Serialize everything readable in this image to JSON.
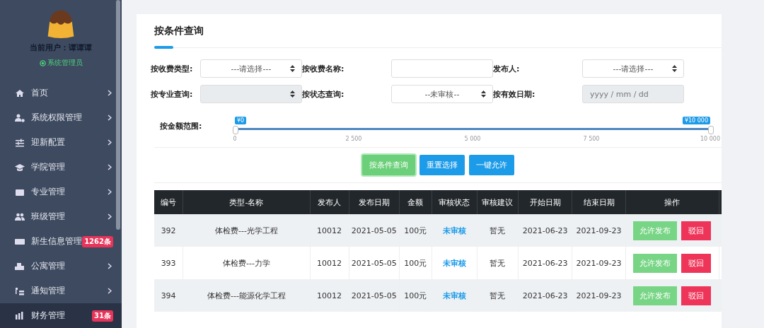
{
  "sidebar": {
    "user_label": "当前用户：",
    "user_name": "谭谭谭",
    "role": "系统管理员",
    "items": [
      {
        "label": "首页",
        "selected": false
      },
      {
        "label": "系统权限管理",
        "selected": false
      },
      {
        "label": "迎新配置",
        "selected": false
      },
      {
        "label": "学院管理",
        "selected": false
      },
      {
        "label": "专业管理",
        "selected": false
      },
      {
        "label": "班级管理",
        "selected": false
      },
      {
        "label": "新生信息管理",
        "selected": false,
        "badge": "1262条"
      },
      {
        "label": "公寓管理",
        "selected": false
      },
      {
        "label": "通知管理",
        "selected": false
      },
      {
        "label": "财务管理",
        "selected": true,
        "badge": "31条"
      }
    ]
  },
  "panel": {
    "title": "按条件查询",
    "filters": [
      {
        "label": "按收费类型:",
        "kind": "select",
        "value": "---请选择---",
        "disabled": false
      },
      {
        "label": "按收费名称:",
        "kind": "text",
        "disabled": false
      },
      {
        "label": "发布人:",
        "kind": "select",
        "value": "---请选择---",
        "disabled": false
      },
      {
        "label": "按专业查询:",
        "kind": "select",
        "disabled": true
      },
      {
        "label": "按状态查询:",
        "kind": "select",
        "value": "--未审核--",
        "disabled": false
      },
      {
        "label": "按有效日期:",
        "kind": "date",
        "placeholder": "yyyy / mm / dd",
        "disabled": true
      }
    ],
    "range": {
      "label": "按金额范围:",
      "handles": [
        {
          "label": "¥0",
          "level": 0
        },
        {
          "label": "¥10 000",
          "level": 1
        }
      ],
      "ticks": [
        "0",
        "2 500",
        "5 000",
        "7 500",
        "10 000"
      ]
    },
    "buttons": [
      {
        "label": "按条件查询",
        "kind": "success"
      },
      {
        "label": "重置选择",
        "kind": "primary"
      },
      {
        "label": "一键允许",
        "kind": "primary"
      }
    ]
  },
  "table": {
    "columns": [
      "编号",
      "类型-名称",
      "发布人",
      "发布日期",
      "金额",
      "审核状态",
      "审核建议",
      "开始日期",
      "结束日期",
      "操作"
    ],
    "rows": [
      {
        "cells": [
          "392",
          "体检费---光学工程",
          "10012",
          "2021-05-05",
          "100元",
          "未审核",
          "暂无",
          "2021-06-23",
          "2021-09-23"
        ],
        "actions": [
          "允许发布",
          "驳回"
        ]
      },
      {
        "cells": [
          "393",
          "体检费---力学",
          "10012",
          "2021-05-05",
          "100元",
          "未审核",
          "暂无",
          "2021-06-23",
          "2021-09-23"
        ],
        "actions": [
          "允许发布",
          "驳回"
        ]
      },
      {
        "cells": [
          "394",
          "体检费---能源化学工程",
          "10012",
          "2021-05-05",
          "100元",
          "未审核",
          "暂无",
          "2021-06-23",
          "2021-09-23"
        ],
        "actions": [
          "允许发布",
          "驳回"
        ]
      }
    ]
  }
}
